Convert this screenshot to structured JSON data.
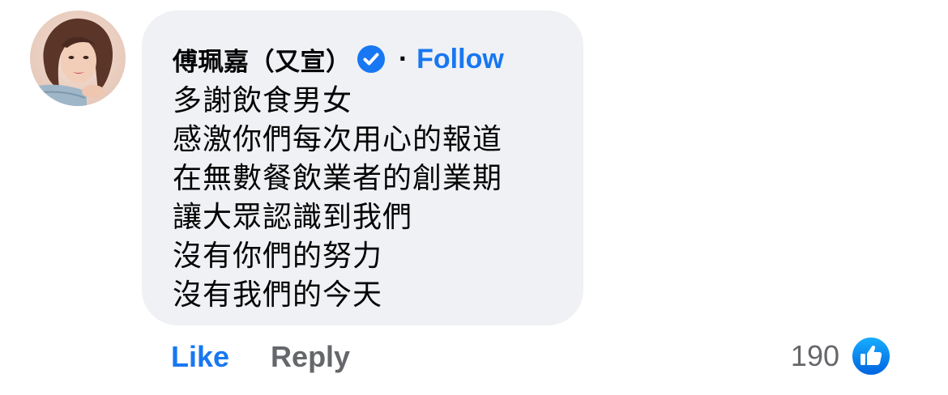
{
  "comment": {
    "author": {
      "name": "傅珮嘉（又宣）",
      "verified": true,
      "avatar_icon": "profile-photo",
      "follow_label": "Follow",
      "separator": "·"
    },
    "body_lines": [
      "多謝飲食男女",
      "感激你們每次用心的報道",
      "在無數餐飲業者的創業期",
      "讓大眾認識到我們",
      "沒有你們的努力",
      "沒有我們的今天"
    ],
    "actions": {
      "like_label": "Like",
      "reply_label": "Reply"
    },
    "reactions": {
      "count": "190",
      "icon": "like-reaction-icon"
    }
  },
  "colors": {
    "accent": "#1877f2",
    "bubble_bg": "#eff1f4",
    "text_primary": "#050505",
    "text_secondary": "#65676b"
  }
}
